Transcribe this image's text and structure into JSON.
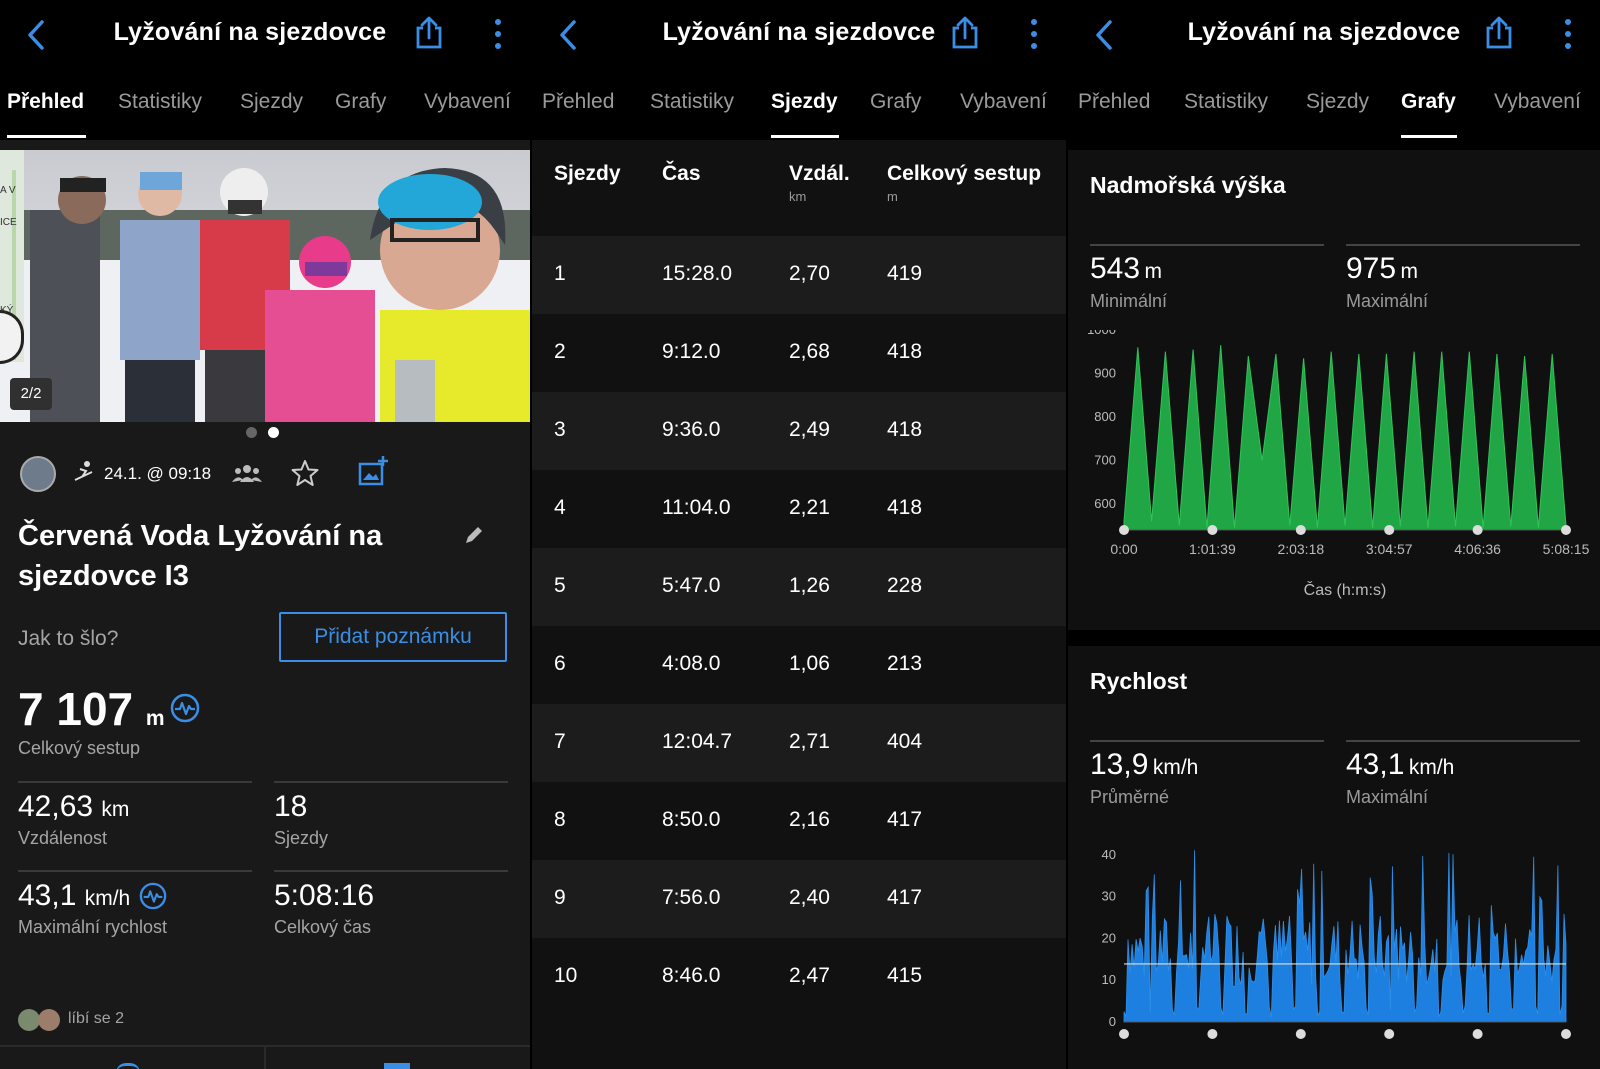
{
  "header": {
    "title": "Lyžování na sjezdovce"
  },
  "tabs": [
    "Přehled",
    "Statistiky",
    "Sjezdy",
    "Grafy",
    "Vybavení"
  ],
  "overview": {
    "photo_counter": "2/2",
    "map_labels": [
      "A V",
      "ICE",
      "KÝ"
    ],
    "date": "24.1. @ 09:18",
    "activity_title": "Červená Voda Lyžování na sjezdovce I3",
    "how_prompt": "Jak to šlo?",
    "add_note_button": "Přidat poznámku",
    "total_descent_value": "7 107",
    "total_descent_unit": "m",
    "total_descent_label": "Celkový sestup",
    "distance_value": "42,63",
    "distance_unit": "km",
    "distance_label": "Vzdálenost",
    "runs_value": "18",
    "runs_label": "Sjezdy",
    "max_speed_value": "43,1",
    "max_speed_unit": "km/h",
    "max_speed_label": "Maximální rychlost",
    "total_time_value": "5:08:16",
    "total_time_label": "Celkový čas",
    "likes": "líbí se 2"
  },
  "runs_table": {
    "headers": [
      "Sjezdy",
      "Čas",
      "Vzdál.",
      "Celkový sestup"
    ],
    "subheaders": [
      "",
      "",
      "km",
      "m"
    ],
    "rows": [
      [
        "1",
        "15:28.0",
        "2,70",
        "419"
      ],
      [
        "2",
        "9:12.0",
        "2,68",
        "418"
      ],
      [
        "3",
        "9:36.0",
        "2,49",
        "418"
      ],
      [
        "4",
        "11:04.0",
        "2,21",
        "418"
      ],
      [
        "5",
        "5:47.0",
        "1,26",
        "228"
      ],
      [
        "6",
        "4:08.0",
        "1,06",
        "213"
      ],
      [
        "7",
        "12:04.7",
        "2,71",
        "404"
      ],
      [
        "8",
        "8:50.0",
        "2,16",
        "417"
      ],
      [
        "9",
        "7:56.0",
        "2,40",
        "417"
      ],
      [
        "10",
        "8:46.0",
        "2,47",
        "415"
      ]
    ]
  },
  "charts": {
    "elevation": {
      "title": "Nadmořská výška",
      "min_value": "543",
      "min_unit": "m",
      "min_label": "Minimální",
      "max_value": "975",
      "max_unit": "m",
      "max_label": "Maximální",
      "xlabel": "Čas (h:m:s)"
    },
    "speed": {
      "title": "Rychlost",
      "avg_value": "13,9",
      "avg_unit": "km/h",
      "avg_label": "Průměrné",
      "max_value": "43,1",
      "max_unit": "km/h",
      "max_label": "Maximální"
    }
  },
  "chart_data": [
    {
      "type": "area",
      "title": "Nadmořská výška",
      "xlabel": "Čas (h:m:s)",
      "ylabel": "",
      "x_ticks": [
        "0:00",
        "1:01:39",
        "2:03:18",
        "3:04:57",
        "4:06:36",
        "5:08:15"
      ],
      "y_ticks": [
        600,
        700,
        800,
        900,
        1000
      ],
      "ylim": [
        540,
        1000
      ],
      "color": "#21a645",
      "series": [
        {
          "values": [
            560,
            960,
            560,
            950,
            550,
            955,
            545,
            965,
            545,
            940,
            700,
            945,
            550,
            935,
            545,
            950,
            550,
            945,
            545,
            945,
            548,
            950,
            545,
            950,
            548,
            950,
            545,
            945,
            548,
            940,
            545,
            945,
            550
          ]
        }
      ]
    },
    {
      "type": "area",
      "title": "Rychlost",
      "xlabel": "",
      "ylabel": "",
      "y_ticks": [
        0,
        10,
        20,
        30,
        40
      ],
      "ylim": [
        0,
        43.1
      ],
      "average": 13.9,
      "color": "#1d7fe0",
      "series": [
        {
          "values": []
        }
      ]
    }
  ],
  "colors": {
    "accent": "#3a8ee6",
    "elevation": "#21a645",
    "speed": "#1d7fe0",
    "background": "#000000",
    "card": "#1a1a1a"
  }
}
